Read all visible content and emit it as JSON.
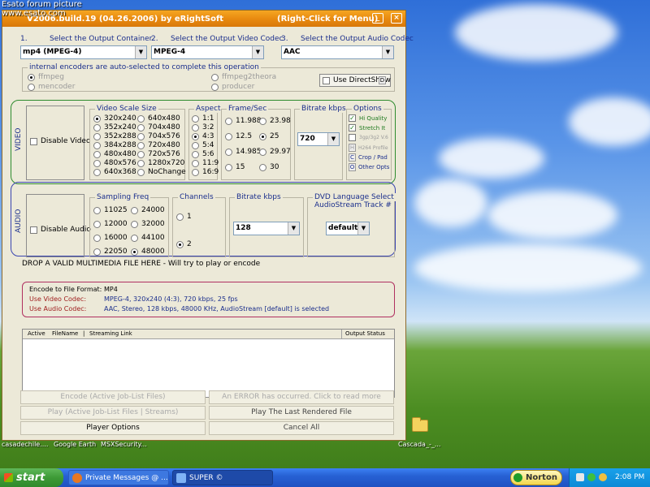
{
  "watermark": {
    "line1": "Esato forum picture",
    "line2": "www.esato.com"
  },
  "window": {
    "title_left": "V2006.build.19 (04.26.2006) by eRightSoft",
    "title_right": "(Right-Click for Menu)",
    "minimize": "_",
    "close": "×"
  },
  "selectors": {
    "container": {
      "label_num": "1.",
      "label": "Select the Output Container",
      "value": "mp4  (MPEG-4)"
    },
    "video_codec": {
      "label_num": "2.",
      "label": "Select the Output Video Codec",
      "value": "MPEG-4"
    },
    "audio_codec": {
      "label_num": "3.",
      "label": "Select the Output Audio Codec",
      "value": "AAC"
    }
  },
  "encoders": {
    "title": "internal encoders are auto-selected to complete this operation",
    "items": [
      "ffmpeg",
      "mencoder",
      "ffmpeg2theora",
      "producer"
    ],
    "use_directshow": "Use DirectShow",
    "directshow_key": "D"
  },
  "video": {
    "side_label": "VIDEO",
    "disable_label": "Disable Video",
    "scale": {
      "title": "Video Scale Size",
      "col1": [
        "320x240",
        "352x240",
        "352x288",
        "384x288",
        "480x480",
        "480x576",
        "640x368"
      ],
      "col2": [
        "640x480",
        "704x480",
        "704x576",
        "720x480",
        "720x576",
        "1280x720",
        "NoChange"
      ],
      "selected": "320x240"
    },
    "aspect": {
      "title": "Aspect",
      "items": [
        "1:1",
        "3:2",
        "4:3",
        "5:4",
        "5:6",
        "11:9",
        "16:9"
      ],
      "selected": "4:3"
    },
    "fps": {
      "title": "Frame/Sec",
      "col1": [
        "11.988",
        "12.5",
        "14.985",
        "15"
      ],
      "col2": [
        "23.98",
        "25",
        "29.97",
        "30"
      ],
      "selected": "25"
    },
    "bitrate": {
      "title": "Bitrate  kbps",
      "value": "720"
    },
    "options": {
      "title": "Options",
      "hi_quality": "Hi Quality",
      "stretch": "Stretch It",
      "gp3": "3gp/3g2 V.6",
      "h264_key": "H",
      "h264": "H264 Profile",
      "crop_key": "C",
      "crop": "Crop / Pad",
      "other_key": "O",
      "other": "Other Opts"
    }
  },
  "audio": {
    "side_label": "AUDIO",
    "disable_label": "Disable Audio",
    "freq": {
      "title": "Sampling Freq",
      "col1": [
        "11025",
        "12000",
        "16000",
        "22050"
      ],
      "col2": [
        "24000",
        "32000",
        "44100",
        "48000"
      ],
      "selected": "48000"
    },
    "channels": {
      "title": "Channels",
      "items": [
        "1",
        "2"
      ],
      "selected": "2"
    },
    "bitrate": {
      "title": "Bitrate  kbps",
      "value": "128"
    },
    "dvd": {
      "title1": "DVD Language Select",
      "title2": "AudioStream  Track #",
      "value": "default"
    }
  },
  "drop_text": "DROP A VALID MULTIMEDIA FILE HERE - Will try to play or encode",
  "info": {
    "format_label": "Encode to File Format:",
    "format_value": "MP4",
    "video_label": "Use Video Codec:",
    "video_value": "MPEG-4,  320x240 (4:3),  720 kbps,  25 fps",
    "audio_label": "Use Audio Codec:",
    "audio_value": "AAC,  Stereo,  128 kbps,  48000 KHz,  AudioStream [default] is selected"
  },
  "jobtable": {
    "col_active": "Active",
    "col_file": "FileName",
    "col_sep": "|",
    "col_link": "Streaming Link",
    "col_status": "Output Status"
  },
  "buttons": {
    "encode": "Encode (Active Job-List Files)",
    "error": "An ERROR has occurred. Click to read more",
    "play": "Play (Active Job-List Files | Streams)",
    "play_last": "Play The Last Rendered File",
    "player_options": "Player Options",
    "cancel_all": "Cancel All"
  },
  "desktop": {
    "labels": [
      "casadechile....",
      "Google Earth",
      "MSXSecurity...",
      "Cascada_-_..."
    ]
  },
  "taskbar": {
    "start": "start",
    "tasks": [
      "Private Messages @ ...",
      "SUPER ©"
    ],
    "norton": "Norton",
    "clock": "2:08 PM"
  },
  "colors": {
    "title_orange": "#e98b10",
    "section_green": "#2e8b2e",
    "section_blue": "#3a45b0",
    "section_red": "#b03060"
  }
}
